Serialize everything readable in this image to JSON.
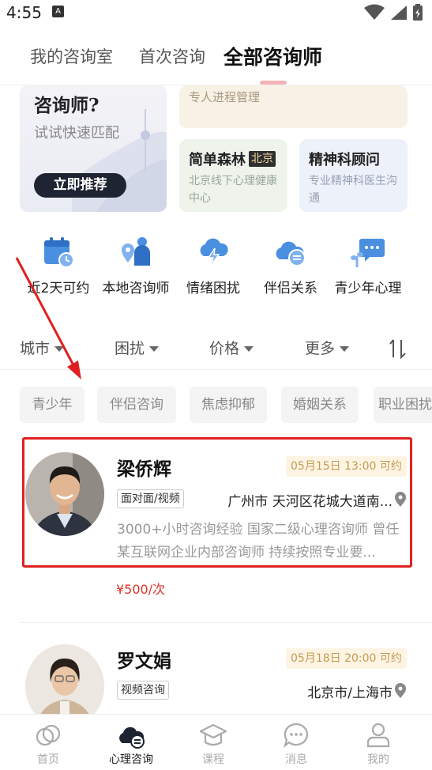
{
  "status_bar": {
    "time": "4:55",
    "badge": "A"
  },
  "top_tabs": {
    "items": [
      "我的咨询室",
      "首次咨询",
      "全部咨询师"
    ],
    "active": "全部咨询师"
  },
  "promo": {
    "match": {
      "title": "咨询师?",
      "subtitle": "试试快速匹配",
      "button": "立即推荐"
    },
    "progress": {
      "subtitle": "专人进程管理"
    },
    "forest": {
      "title": "简单森林",
      "tag": "北京",
      "desc": "北京线下心理健康中心"
    },
    "psychiatry": {
      "title": "精神科顾问",
      "desc": "专业精神科医生沟通"
    }
  },
  "categories": [
    {
      "label": "近2天可约",
      "icon": "calendar-icon"
    },
    {
      "label": "本地咨询师",
      "icon": "local-counselor-icon"
    },
    {
      "label": "情绪困扰",
      "icon": "cloud-lightning-icon"
    },
    {
      "label": "伴侣关系",
      "icon": "cloud-card-icon"
    },
    {
      "label": "青少年心理",
      "icon": "chat-plant-icon"
    }
  ],
  "filters": [
    "城市",
    "困扰",
    "价格",
    "更多"
  ],
  "chips": [
    "青少年",
    "伴侣咨询",
    "焦虑抑郁",
    "婚姻关系",
    "职业困扰"
  ],
  "counselors": [
    {
      "name": "梁侨辉",
      "availability": "05月15日 13:00 可约",
      "mode": "面对面/视频",
      "location": "广州市 天河区花城大道南...",
      "description": "3000+小时咨询经验 国家二级心理咨询师 曾任某互联网企业内部咨询师 持续按照专业要...",
      "price": "¥500/次"
    },
    {
      "name": "罗文娟",
      "availability": "05月18日 20:00 可约",
      "mode": "视频咨询",
      "location": "北京市/上海市"
    }
  ],
  "bottom_nav": [
    {
      "label": "首页",
      "icon": "home-icon"
    },
    {
      "label": "心理咨询",
      "icon": "counsel-icon",
      "active": true
    },
    {
      "label": "课程",
      "icon": "course-icon"
    },
    {
      "label": "消息",
      "icon": "message-icon"
    },
    {
      "label": "我的",
      "icon": "profile-icon"
    }
  ],
  "colors": {
    "accent_red": "#e02020",
    "price_red": "#d9342b",
    "icon_blue": "#4a8fe0",
    "appt_gold": "#c59a50"
  }
}
